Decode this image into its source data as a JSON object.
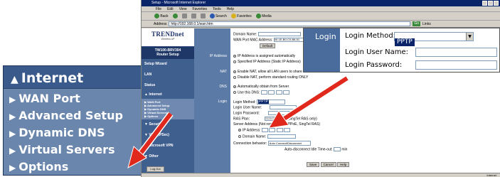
{
  "zoom_menu": {
    "header": "Internet",
    "items": [
      "WAN Port",
      "Advanced Setup",
      "Dynamic DNS",
      "Virtual Servers",
      "Options"
    ]
  },
  "browser": {
    "title": "Setup - Microsoft Internet Explorer",
    "menu": [
      "File",
      "Edit",
      "View",
      "Favorites",
      "Tools",
      "Help"
    ],
    "toolbar": {
      "back": "Back",
      "search": "Search",
      "favorites": "Favorites",
      "media": "Media"
    },
    "address_label": "Address",
    "address_value": "http://192.168.0.1/wan.htm",
    "go": "Go",
    "links": "Links"
  },
  "router": {
    "brand": "TRENDnet",
    "slogan": "Wireless AP",
    "model": "TW100-BRV304",
    "model_sub": "Router Setup",
    "nav": [
      "Setup Wizard",
      "LAN",
      "Status"
    ],
    "internet_header": "Internet",
    "internet_sub": [
      "WAN Port",
      "Advanced Setup",
      "Dynamic DNS",
      "Virtual Servers",
      "Options"
    ],
    "nav_bottom": [
      "Security",
      "VPN (IPSec)",
      "Microsoft VPN",
      "Other"
    ],
    "logout": "Log Out"
  },
  "form": {
    "labels": {
      "ip_address": "IP Address",
      "nat": "NAT",
      "dns": "DNS",
      "login": "Login"
    },
    "domain_name": "Domain Name:",
    "wan_mac_label": "WAN Port MAC Address:",
    "wan_mac_value": "00-1E-B0-C0-B8-51",
    "default_btn": "Default",
    "ip_auto": "IP Address is assigned automatically",
    "ip_static": "Specified IP Address (Static IP Address)",
    "nat_enable": "Enable NAT, allow all LAN users to share",
    "nat_disable": "Disable NAT, perform standard routing ONLY",
    "dns_auto": "Automatically obtain from Server",
    "dns_use": "Use this DNS:",
    "login_method_label": "Login Method:",
    "login_method_value": "PPTP",
    "login_user": "Login User Name:",
    "login_pass": "Login Password:",
    "ras_plan": "RAS Plan:",
    "ras_value": "512k Ethernet",
    "ras_note": "(SingTel RAS only)",
    "server_addr": "Server Address (Not required for PPPoE, SingTel RAS)",
    "srv_ip": "IP Address:",
    "srv_domain": "Domain Name:",
    "conn_label": "Connection behavior:",
    "conn_value": "Auto Connect/Disconnect",
    "idle_label": "Auto-disconnect Idle Time-out:",
    "idle_unit": "min",
    "save": "Save",
    "cancel": "Cancel",
    "help": "Help"
  },
  "callout": {
    "label": "Login",
    "method_label": "Login Method:",
    "method_value": "PPTP",
    "user_label": "Login User Name:",
    "pass_label": "Login Password:"
  },
  "status": {
    "zone": "Internet"
  },
  "colors": {
    "sidebar": "#3f5f8f",
    "accent_red": "#e0291c",
    "select_highlight": "#0a246a"
  }
}
